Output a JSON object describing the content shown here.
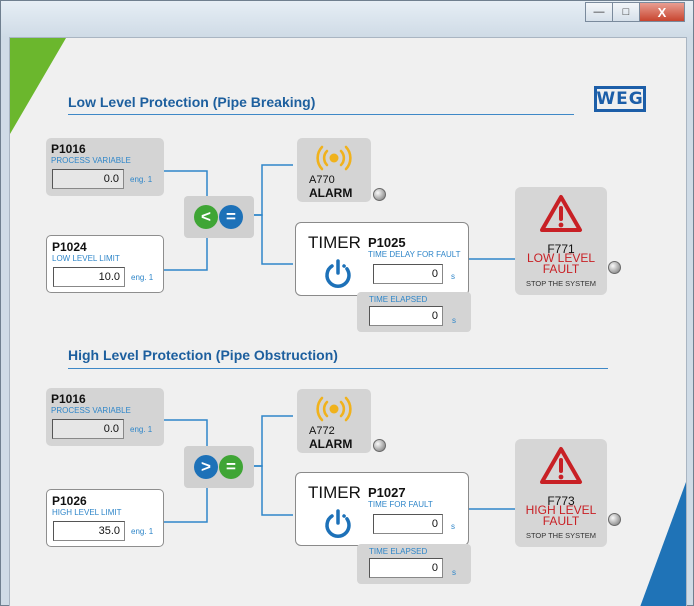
{
  "window": {
    "minimize_glyph": "—",
    "maximize_glyph": "□",
    "close_glyph": "X"
  },
  "logo": {
    "text": "WEG",
    "color": "#1c5ea8"
  },
  "low": {
    "title": "Low Level Protection (Pipe Breaking)",
    "pv": {
      "code": "P1016",
      "label": "PROCESS VARIABLE",
      "value": "0.0",
      "unit": "eng. 1"
    },
    "limit": {
      "code": "P1024",
      "label": "LOW LEVEL LIMIT",
      "value": "10.0",
      "unit": "eng. 1"
    },
    "compare": {
      "left": "<",
      "right": "="
    },
    "alarm": {
      "code": "A770",
      "label": "ALARM"
    },
    "timer": {
      "word": "TIMER",
      "code": "P1025",
      "label": "TIME DELAY FOR FAULT",
      "value": "0",
      "unit": "s"
    },
    "elapsed": {
      "label": "TIME ELAPSED",
      "value": "0",
      "unit": "s"
    },
    "fault": {
      "code": "F771",
      "name_line1": "LOW LEVEL",
      "name_line2": "FAULT",
      "stop": "STOP THE SYSTEM"
    }
  },
  "high": {
    "title": "High Level Protection (Pipe Obstruction)",
    "pv": {
      "code": "P1016",
      "label": "PROCESS VARIABLE",
      "value": "0.0",
      "unit": "eng. 1"
    },
    "limit": {
      "code": "P1026",
      "label": "HIGH LEVEL LIMIT",
      "value": "35.0",
      "unit": "eng. 1"
    },
    "compare": {
      "left": ">",
      "right": "="
    },
    "alarm": {
      "code": "A772",
      "label": "ALARM"
    },
    "timer": {
      "word": "TIMER",
      "code": "P1027",
      "label": "TIME FOR FAULT",
      "value": "0",
      "unit": "s"
    },
    "elapsed": {
      "label": "TIME ELAPSED",
      "value": "0",
      "unit": "s"
    },
    "fault": {
      "code": "F773",
      "name_line1": "HIGH LEVEL",
      "name_line2": "FAULT",
      "stop": "STOP THE SYSTEM"
    }
  },
  "colors": {
    "accent_blue": "#1d5f9e",
    "label_blue": "#2f86c9",
    "alarm_yellow": "#f0b21c",
    "fault_red": "#c82025",
    "compare_green": "#3fa535",
    "compare_blue": "#1d71b8"
  },
  "icons": [
    "alarm-waves-icon",
    "timer-power-icon",
    "warning-triangle-icon"
  ]
}
